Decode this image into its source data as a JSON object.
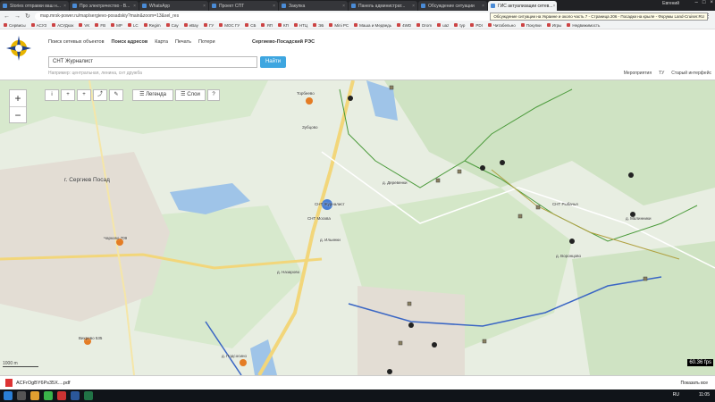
{
  "browser": {
    "tabs": [
      {
        "title": "Stories отправки ваш н...",
        "active": false
      },
      {
        "title": "Про электричество - В...",
        "active": false
      },
      {
        "title": "WhatsApp",
        "active": false
      },
      {
        "title": "Проект СПТ",
        "active": false
      },
      {
        "title": "Закупка",
        "active": false
      },
      {
        "title": "Панель администрат...",
        "active": false
      },
      {
        "title": "Обсуждение ситуации",
        "active": false
      },
      {
        "title": "ГИС актуализации сетев...",
        "active": true
      }
    ],
    "profile": "Евгений",
    "url": "map.mrsk-power.ru/map/sergievo-posadskiy?main&zoom=13&sel_res",
    "tooltip": "Обсуждение ситуации на Украине и около часть 7 - Страница 206 - Посадки на крыле - Форумы Land-Cruiser.RU",
    "bookmarks": [
      "Сервисы",
      "АСУЗ",
      "АСУДкок",
      "VK",
      "FB",
      "MP",
      "LC",
      "Regim",
      "Сау",
      "eBay",
      "ГУ",
      "МОС ГУ",
      "СБ",
      "ЯП",
      "КП",
      "НТЦ",
      "ЭБ",
      "Mini PC",
      "Маша и Медведь",
      "4WD",
      "Drom",
      "uaz",
      "typ",
      "PDI",
      "Читабельно",
      "Покупки",
      "Игры",
      "Недвижимость"
    ]
  },
  "app": {
    "nav": [
      {
        "label": "Поиск сетевых объектов",
        "active": false
      },
      {
        "label": "Поиск адресов",
        "active": true
      },
      {
        "label": "Карта",
        "active": false
      },
      {
        "label": "Печать",
        "active": false
      },
      {
        "label": "Потери",
        "active": false
      }
    ],
    "region": "Сергиево-Посадский РЭС",
    "search_value": "СНТ Журналист",
    "search_button": "Найти",
    "hint": "Например: центральная, ленина, снт дружба",
    "links": [
      "Мероприятия",
      "ТУ",
      "Старый интерфейс"
    ]
  },
  "map": {
    "toolbar": [
      "i",
      "+",
      "+",
      "share",
      "edit"
    ],
    "legend_label": "Легенда",
    "layers_label": "Слои",
    "help_label": "?",
    "zoom_in": "+",
    "zoom_out": "−",
    "scale": "1000 m",
    "fps": "60.36 fps",
    "labels": [
      {
        "text": "г. Сергиев Посад"
      },
      {
        "text": "Торбеево"
      },
      {
        "text": "СНТ Журналист"
      },
      {
        "text": "Зубцово"
      },
      {
        "text": "Чарково 709"
      },
      {
        "text": "Вихрево 535"
      },
      {
        "text": "д. Деревенки"
      },
      {
        "text": "д. Воронцово"
      },
      {
        "text": "д. Ильинки"
      },
      {
        "text": "СНТ Москва"
      },
      {
        "text": "д. Назарово"
      },
      {
        "text": "д. Подсосино"
      },
      {
        "text": "СНТ Рыбачья"
      },
      {
        "text": "д. Малинники"
      }
    ]
  },
  "downloads": {
    "file": "ACFrOgBY6Ps35X....pdf",
    "show_all": "Показать все"
  },
  "taskbar": {
    "lang": "RU",
    "time": "11:05"
  }
}
